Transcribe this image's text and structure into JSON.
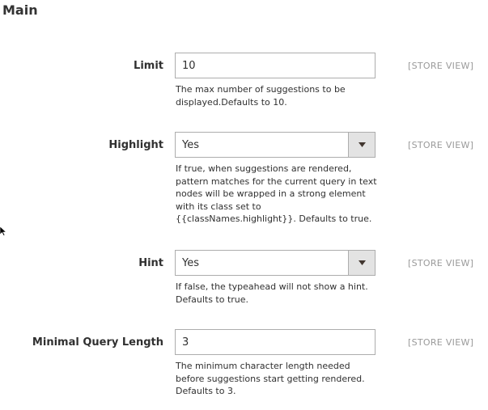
{
  "section": {
    "title": "Main"
  },
  "fields": [
    {
      "label": "Limit",
      "value": "10",
      "scope": "[STORE VIEW]",
      "note": "The max number of suggestions to be displayed.Defaults to 10."
    },
    {
      "label": "Highlight",
      "value": "Yes",
      "scope": "[STORE VIEW]",
      "note": "If true, when suggestions are rendered, pattern matches for the current query in text nodes will be wrapped in a strong element with its class set to {{classNames.highlight}}. Defaults to true."
    },
    {
      "label": "Hint",
      "value": "Yes",
      "scope": "[STORE VIEW]",
      "note": "If false, the typeahead will not show a hint. Defaults to true."
    },
    {
      "label": "Minimal Query Length",
      "value": "3",
      "scope": "[STORE VIEW]",
      "note": "The minimum character length needed before suggestions start getting rendered. Defaults to 3."
    }
  ],
  "icons": {
    "select_arrow": "triangle-down-icon",
    "cursor": "mouse-cursor-icon"
  }
}
